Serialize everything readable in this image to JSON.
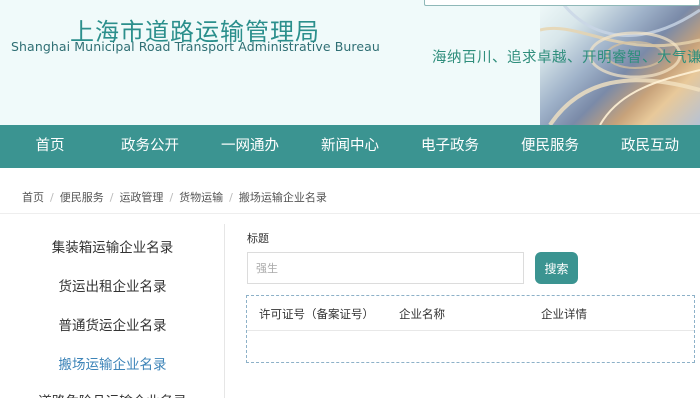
{
  "header": {
    "title_cn": "上海市道路运输管理局",
    "title_en": "Shanghai Municipal Road Transport Administrative Bureau",
    "slogan": "海纳百川、追求卓越、开明睿智、大气谦"
  },
  "nav": [
    {
      "label": "首页"
    },
    {
      "label": "政务公开"
    },
    {
      "label": "一网通办"
    },
    {
      "label": "新闻中心"
    },
    {
      "label": "电子政务"
    },
    {
      "label": "便民服务"
    },
    {
      "label": "政民互动"
    }
  ],
  "breadcrumb": [
    "首页",
    "便民服务",
    "运政管理",
    "货物运输",
    "搬场运输企业名录"
  ],
  "sidebar": {
    "items": [
      {
        "label": "集装箱运输企业名录",
        "active": false
      },
      {
        "label": "货运出租企业名录",
        "active": false
      },
      {
        "label": "普通货运企业名录",
        "active": false
      },
      {
        "label": "搬场运输企业名录",
        "active": true
      },
      {
        "label": "道路危险品运输企业名录",
        "active": false
      }
    ]
  },
  "search": {
    "label": "标题",
    "placeholder": "强生",
    "button_label": "搜索"
  },
  "table": {
    "columns": [
      "许可证号（备案证号）",
      "企业名称",
      "企业详情"
    ],
    "rows": []
  },
  "colors": {
    "primary": "#3b9491",
    "active_link": "#3d84b8",
    "title": "#2b8f8c"
  }
}
